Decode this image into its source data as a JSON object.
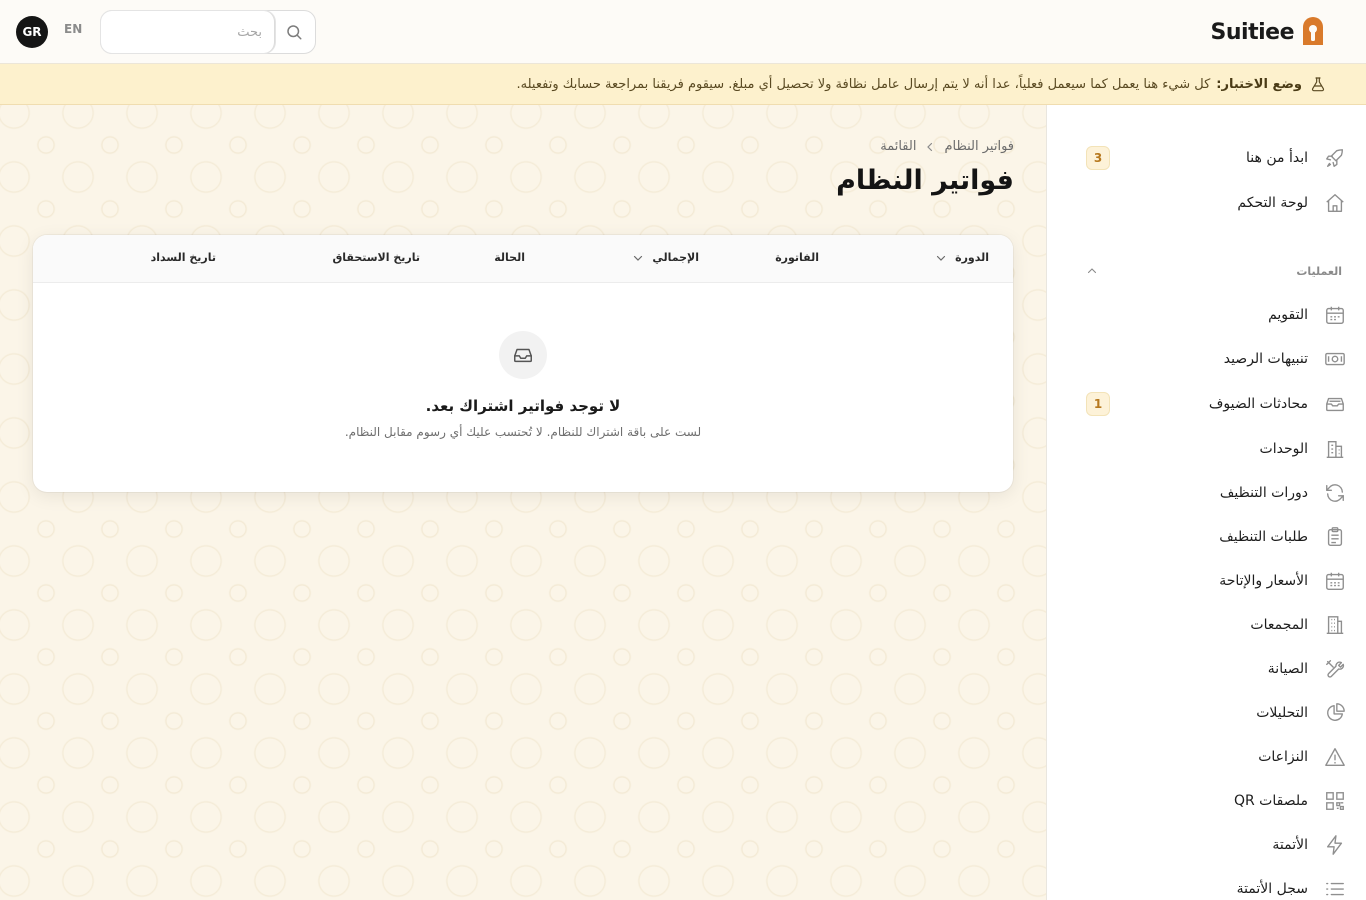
{
  "header": {
    "avatar_initials": "GR",
    "language": "EN",
    "search_placeholder": "بحث",
    "brand": "Suitiee",
    "brand_color": "#d97a2b"
  },
  "banner": {
    "strong": "وضع الاختبار:",
    "text": "كل شيء هنا يعمل كما سيعمل فعلياً، عدا أنه لا يتم إرسال عامل نظافة ولا تحصيل أي مبلغ. سيقوم فريقنا بمراجعة حسابك وتفعيله."
  },
  "page": {
    "breadcrumb_parent": "القائمة",
    "breadcrumb_current": "فواتير النظام",
    "title": "فواتير النظام"
  },
  "table": {
    "columns": {
      "cycle": "الدورة",
      "invoice": "الفاتورة",
      "total": "الإجمالي",
      "status": "الحالة",
      "due_date": "تاريخ الاستحقاق",
      "payment_date": "تاريخ السداد"
    },
    "empty_title": "لا توجد فواتير اشتراك بعد.",
    "empty_subtitle": "لست على باقة اشتراك للنظام. لا تُحتسب عليك أي رسوم مقابل النظام."
  },
  "sidebar": {
    "top_items": [
      {
        "label": "ابدأ من هنا",
        "icon": "rocket-icon",
        "badge": "3"
      },
      {
        "label": "لوحة التحكم",
        "icon": "home-icon"
      }
    ],
    "section_label": "العمليات",
    "items": [
      {
        "label": "التقويم",
        "icon": "calendar-icon"
      },
      {
        "label": "تنبيهات الرصيد",
        "icon": "banknote-icon"
      },
      {
        "label": "محادثات الضيوف",
        "icon": "inbox-icon",
        "badge": "1"
      },
      {
        "label": "الوحدات",
        "icon": "building-icon"
      },
      {
        "label": "دورات التنظيف",
        "icon": "refresh-icon"
      },
      {
        "label": "طلبات التنظيف",
        "icon": "clipboard-icon"
      },
      {
        "label": "الأسعار والإتاحة",
        "icon": "calendar-grid-icon"
      },
      {
        "label": "المجمعات",
        "icon": "office-icon"
      },
      {
        "label": "الصيانة",
        "icon": "tools-icon"
      },
      {
        "label": "التحليلات",
        "icon": "pie-chart-icon"
      },
      {
        "label": "النزاعات",
        "icon": "warning-icon"
      },
      {
        "label": "ملصقات QR",
        "icon": "qr-icon"
      },
      {
        "label": "الأتمتة",
        "icon": "bolt-icon"
      },
      {
        "label": "سجل الأتمتة",
        "icon": "list-icon"
      }
    ]
  }
}
